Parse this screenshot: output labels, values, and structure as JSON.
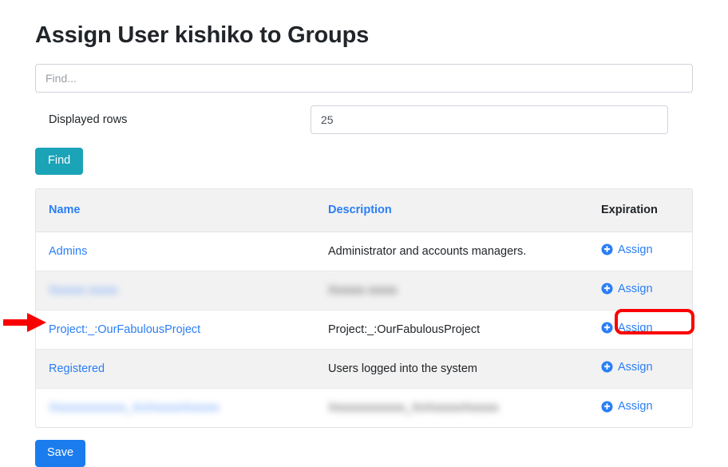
{
  "page": {
    "title": "Assign User kishiko to Groups"
  },
  "search": {
    "placeholder": "Find...",
    "value": ""
  },
  "displayed_rows": {
    "label": "Displayed rows",
    "value": "25"
  },
  "buttons": {
    "find_label": "Find",
    "save_label": "Save"
  },
  "table": {
    "headers": {
      "name": "Name",
      "description": "Description",
      "expiration": "Expiration"
    },
    "rows": [
      {
        "name": "Admins",
        "description": "Administrator and accounts managers.",
        "expiration": "",
        "action_label": "Assign",
        "redacted": false,
        "highlighted": false
      },
      {
        "name": "Xxxxxx xxxxx",
        "description": "Xxxxxx xxxxx",
        "expiration": "",
        "action_label": "Assign",
        "redacted": true,
        "highlighted": false
      },
      {
        "name": "Project:_:OurFabulousProject",
        "description": "Project:_:OurFabulousProject",
        "expiration": "",
        "action_label": "Assign",
        "redacted": false,
        "highlighted": true
      },
      {
        "name": "Registered",
        "description": "Users logged into the system",
        "expiration": "",
        "action_label": "Assign",
        "redacted": false,
        "highlighted": false
      },
      {
        "name": "Xxxxxxxxxxxxx_XxXxxxxxXxxxxx",
        "description": "Xxxxxxxxxxxxx_XxXxxxxxXxxxxx",
        "expiration": "",
        "action_label": "Assign",
        "redacted": true,
        "highlighted": false
      }
    ]
  },
  "icons": {
    "assign": "plus-circle-icon",
    "annotation_arrow": "red-arrow-icon",
    "annotation_box": "red-highlight-box"
  },
  "colors": {
    "link_blue": "#2a7ef5",
    "find_teal": "#1ba3b8",
    "save_blue": "#1b7ced",
    "annotation_red": "#fb0000",
    "row_stripe": "#f2f2f2",
    "header_bg": "#f2f2f2"
  }
}
